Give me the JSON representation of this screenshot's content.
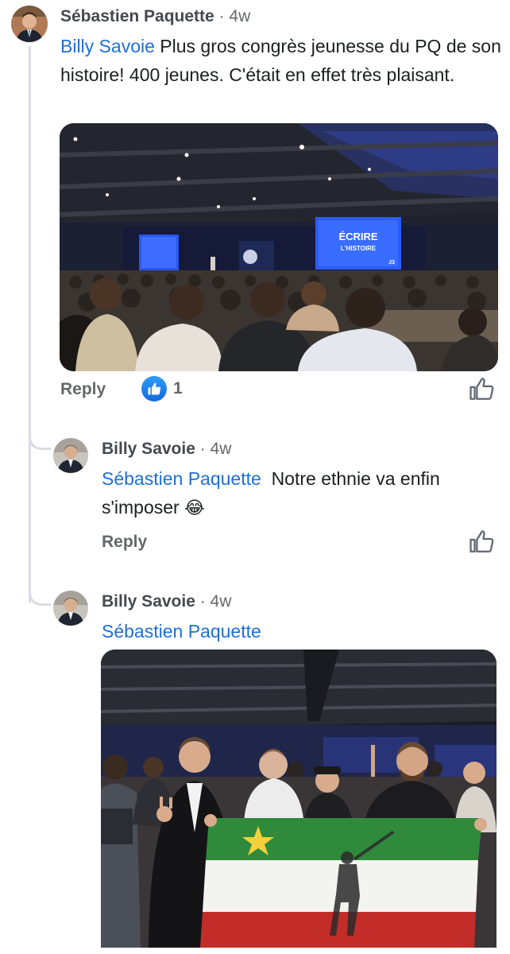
{
  "comments": [
    {
      "author": "Sébastien Paquette",
      "time": "· 4w",
      "mention": "Billy Savoie",
      "text": "Plus gros congrès jeunesse du PQ de son histoire! 400 jeunes. C'était en effet très plaisant.",
      "media": {
        "screen_left_text": "",
        "screen_main_line1": "ÉCRIRE",
        "screen_main_line2": "L'HISTOIRE",
        "screen_logo": "J3"
      },
      "reply_label": "Reply",
      "like_count": "1"
    },
    {
      "author": "Billy Savoie",
      "time": "· 4w",
      "mention": "Sébastien Paquette",
      "text": "Notre ethnie va enfin s'imposer",
      "emoji": "😂",
      "reply_label": "Reply"
    },
    {
      "author": "Billy Savoie",
      "time": "· 4w",
      "mention": "Sébastien Paquette",
      "text": ""
    }
  ],
  "colors": {
    "mention": "#1f6fd6",
    "like_badge": "#1877f2",
    "thread_line": "#d9dce1",
    "secondary_text": "#65676b"
  },
  "icons": {
    "like_outline": "thumbs-up-outline-icon",
    "like_badge": "thumbs-up-badge-icon"
  }
}
